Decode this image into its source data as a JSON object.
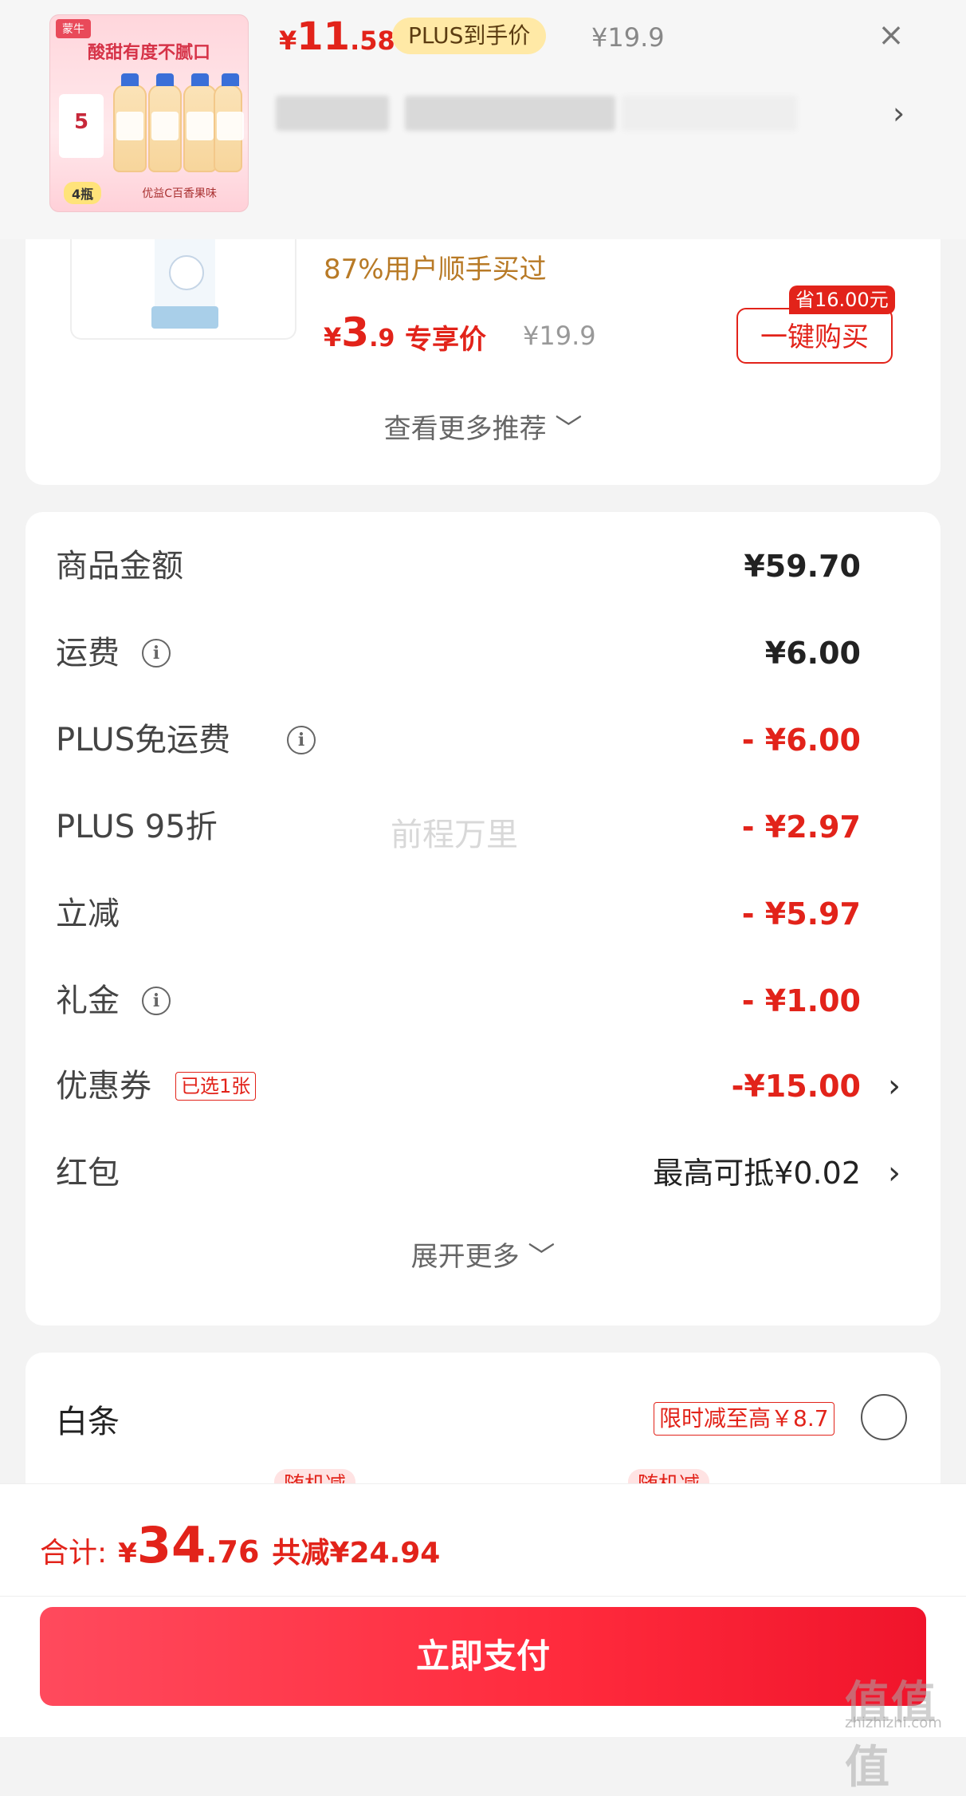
{
  "top_header": {
    "thumb": {
      "brand": "蒙牛",
      "slogan": "酸甜有度不腻口",
      "price_mark": "5",
      "count": "4瓶",
      "flavor": "优益C百香果味"
    },
    "price_currency": "¥",
    "price_int": "11",
    "price_dec": ".58",
    "plus_label": "PLUS到手价",
    "original_price": "¥19.9",
    "chevron": "›",
    "close": "×"
  },
  "recommend": {
    "subtitle": "87%用户顺手买过",
    "price_currency": "¥",
    "price_int": "3",
    "price_dec": ".9",
    "exclusive_label": "专享价",
    "original_price": "¥19.9",
    "save_tag": "省16.00元",
    "buy_label": "一键购买",
    "see_more": "查看更多推荐 ﹀"
  },
  "summary": {
    "rows": [
      {
        "label": "商品金额",
        "value": "¥59.70"
      },
      {
        "label": "运费",
        "value": "¥6.00"
      },
      {
        "label": "PLUS免运费",
        "value": "- ¥6.00"
      },
      {
        "label": "PLUS 95折",
        "value": "- ¥2.97"
      },
      {
        "label": "立减",
        "value": "- ¥5.97"
      },
      {
        "label": "礼金",
        "value": "- ¥1.00"
      },
      {
        "label": "优惠券",
        "value": "-¥15.00",
        "tag": "已选1张"
      },
      {
        "label": "红包",
        "value": "最高可抵¥0.02"
      }
    ],
    "expand_more": "展开更多 ﹀"
  },
  "baitiao": {
    "label": "白条",
    "limit_tag": "限时减至高￥8.7",
    "random_tag": "随机减"
  },
  "bottom": {
    "total_label": "合计:",
    "currency": "¥",
    "total_int": "34",
    "total_dec": ".76",
    "saved": "共减¥24.94",
    "pay_label": "立即支付"
  },
  "watermarks": {
    "center": "前程万里",
    "corner": "值值值",
    "corner_url": "zhizhizhi.com"
  },
  "colors": {
    "accent_red": "#e2231a",
    "plus_gold": "#ffe9a6",
    "recommend_sub": "#b87a26"
  }
}
